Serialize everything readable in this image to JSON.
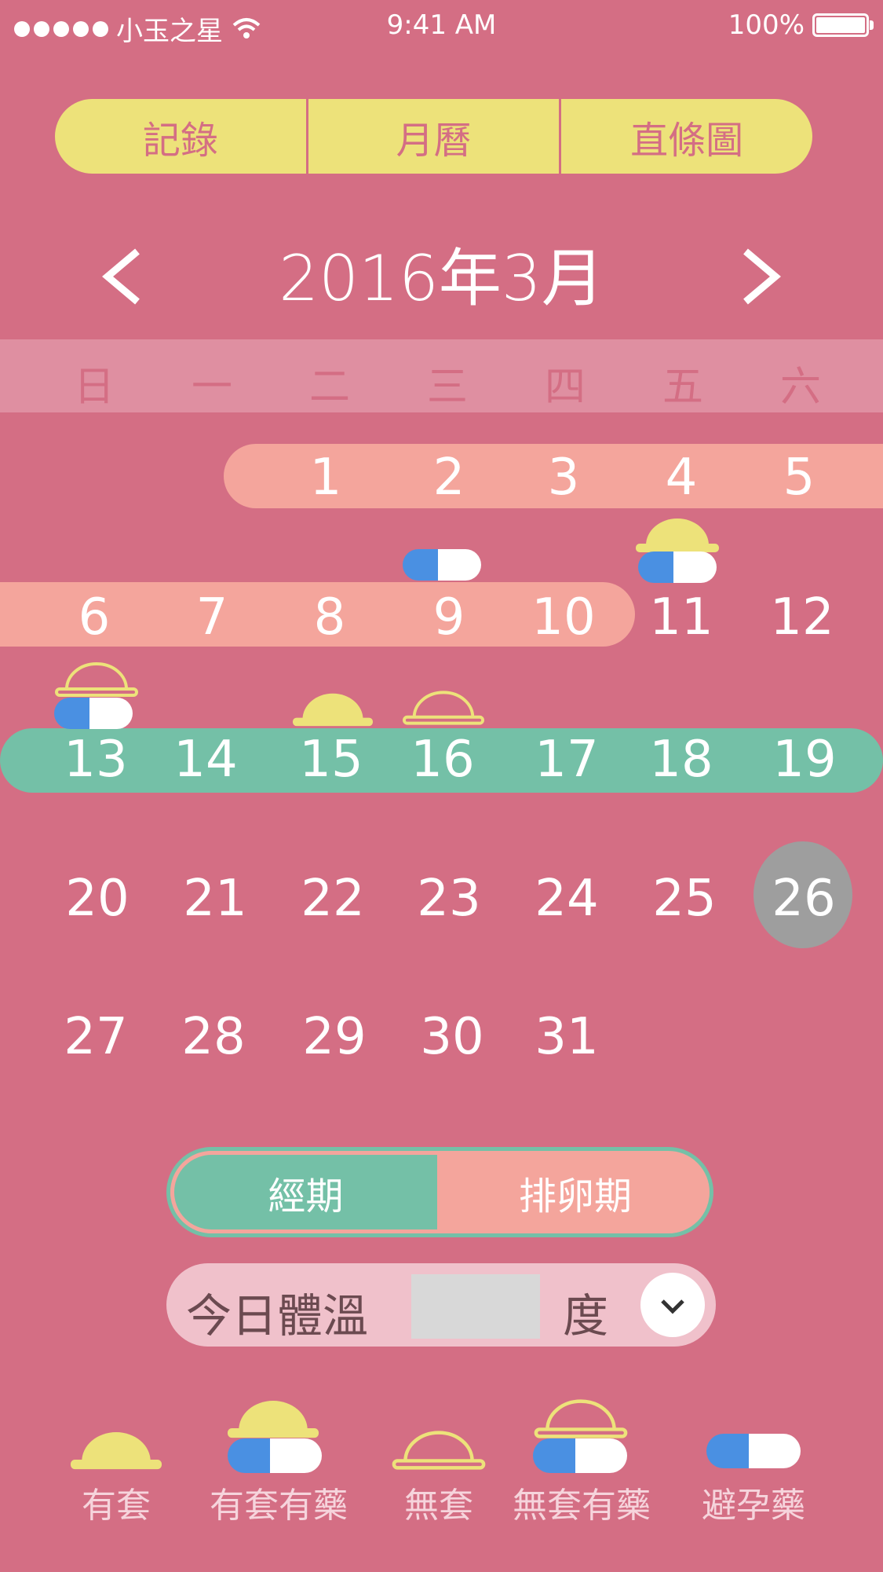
{
  "status_bar": {
    "carrier": "小玉之星",
    "time": "9:41 AM",
    "battery": "100%"
  },
  "tabs": [
    {
      "label": "記錄"
    },
    {
      "label": "月曆"
    },
    {
      "label": "直條圖"
    }
  ],
  "calendar": {
    "month_title": "2016年3月",
    "weekdays": [
      "日",
      "一",
      "二",
      "三",
      "四",
      "五",
      "六"
    ],
    "weeks": [
      [
        "",
        "1",
        "2",
        "3",
        "4",
        "5"
      ],
      [
        "6",
        "7",
        "8",
        "9",
        "10",
        "11",
        "12"
      ],
      [
        "13",
        "14",
        "15",
        "16",
        "17",
        "18",
        "19"
      ],
      [
        "20",
        "21",
        "22",
        "23",
        "24",
        "25",
        "26"
      ],
      [
        "27",
        "28",
        "29",
        "30",
        "31"
      ]
    ],
    "today": "26",
    "colors": {
      "background": "#d46e84",
      "period_band": "#f4a59c",
      "ovulation_band": "#74c0a7",
      "accent_yellow": "#ede27a",
      "pill_blue": "#4a90e2",
      "today_circle": "#9e9e9e"
    }
  },
  "toggle": {
    "period": "經期",
    "ovulation": "排卵期"
  },
  "temperature": {
    "label": "今日體溫",
    "value": "",
    "unit": "度"
  },
  "legend": [
    {
      "label": "有套",
      "icon": "filled-hat-icon"
    },
    {
      "label": "有套有藥",
      "icon": "filled-hat-pill-icon"
    },
    {
      "label": "無套",
      "icon": "outline-hat-icon"
    },
    {
      "label": "無套有藥",
      "icon": "outline-hat-pill-icon"
    },
    {
      "label": "避孕藥",
      "icon": "pill-icon"
    }
  ]
}
